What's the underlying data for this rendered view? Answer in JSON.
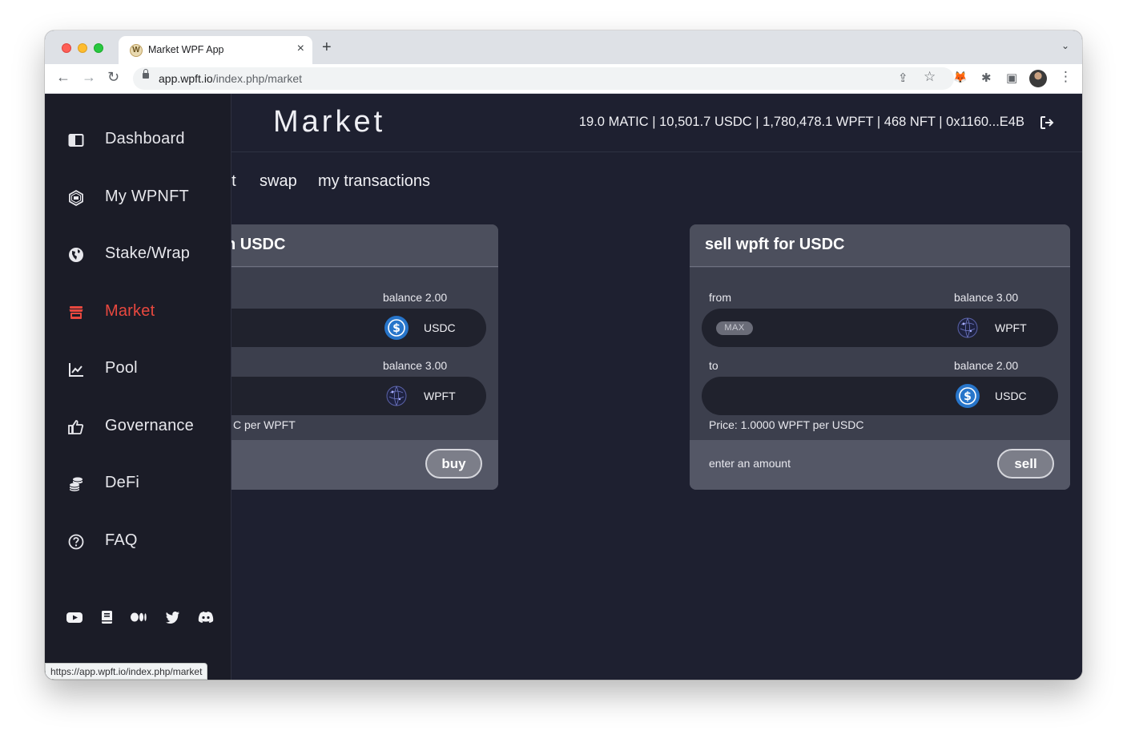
{
  "browser": {
    "tab_title": "Market WPF App",
    "tab_favicon": "W",
    "close_glyph": "×",
    "newtab_glyph": "+",
    "menu_glyph": "⌄",
    "url_host": "app.wpft.io",
    "url_path": "/index.php/market",
    "status_url": "https://app.wpft.io/index.php/market",
    "nav_glyphs": {
      "back": "←",
      "forward": "→",
      "reload": "↻"
    },
    "toolbar_glyphs": {
      "share": "⇪",
      "star": "☆",
      "fox": "🦊",
      "puzzle": "✱",
      "panel": "▣",
      "more": "⋮"
    }
  },
  "sidebar": {
    "items": [
      {
        "label": "Dashboard",
        "icon": "dashboard-icon",
        "active": false
      },
      {
        "label": "My WPNFT",
        "icon": "nft-icon",
        "active": false
      },
      {
        "label": "Stake/Wrap",
        "icon": "globe-icon",
        "active": false
      },
      {
        "label": "Market",
        "icon": "store-icon",
        "active": true
      },
      {
        "label": "Pool",
        "icon": "chart-icon",
        "active": false
      },
      {
        "label": "Governance",
        "icon": "thumbs-up-icon",
        "active": false
      },
      {
        "label": "DeFi",
        "icon": "coins-icon",
        "active": false
      },
      {
        "label": "FAQ",
        "icon": "question-icon",
        "active": false
      }
    ],
    "social": [
      "youtube-icon",
      "book-icon",
      "medium-icon",
      "twitter-icon",
      "discord-icon"
    ]
  },
  "header": {
    "title": "Market",
    "wallet_summary": "19.0 MATIC | 10,501.7 USDC | 1,780,478.1 WPFT | 468 NFT | 0x1160...E4B"
  },
  "subtabs": [
    "et",
    "swap",
    "my transactions"
  ],
  "colors": {
    "accent_red": "#e8483f",
    "usdc_blue": "#2775ca",
    "bg": "#1e2030"
  },
  "buy_card": {
    "title": "h USDC",
    "from_balance": "balance 2.00",
    "from_token": "USDC",
    "to_balance": "balance 3.00",
    "to_token": "WPFT",
    "price": "C per WPFT",
    "button": "buy"
  },
  "sell_card": {
    "title": "sell wpft for USDC",
    "from_label": "from",
    "from_balance": "balance 3.00",
    "max_label": "MAX",
    "from_token": "WPFT",
    "to_label": "to",
    "to_balance": "balance 2.00",
    "to_token": "USDC",
    "price": "Price: 1.0000 WPFT per USDC",
    "hint": "enter an amount",
    "button": "sell"
  }
}
